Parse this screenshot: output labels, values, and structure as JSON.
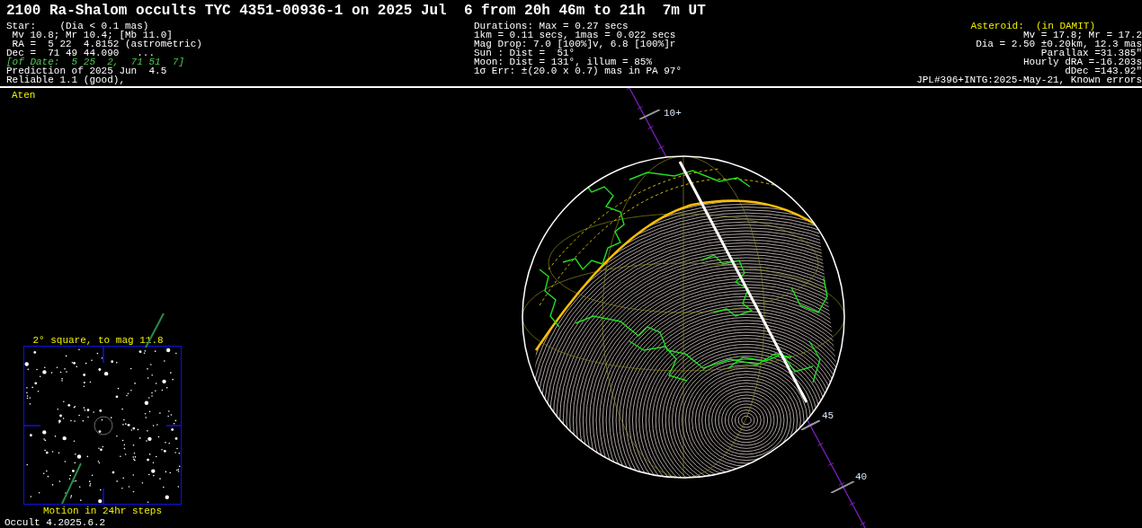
{
  "title": "2100 Ra-Shalom occults TYC 4351-00936-1 on 2025 Jul  6 from 20h 46m to 21h  7m UT",
  "star_info": [
    {
      "kind": "plain",
      "text": "Star:    (Dia < 0.1 mas)"
    },
    {
      "kind": "plain",
      "text": " Mv 10.8; Mr 10.4; [Mb 11.0]"
    },
    {
      "kind": "plain",
      "text": " RA =  5 22  4.8152 (astrometric)"
    },
    {
      "kind": "plain",
      "text": "Dec =  71 49 44.090   ..."
    },
    {
      "kind": "of_date",
      "text": "[of Date:  5 25  2,  71 51  7]"
    },
    {
      "kind": "plain",
      "text": "Prediction of 2025 Jun  4.5"
    },
    {
      "kind": "plain",
      "text": "Reliable 1.1 (good),"
    }
  ],
  "event_info": [
    "Durations: Max = 0.27 secs",
    "1km = 0.11 secs, 1mas = 0.022 secs",
    "Mag Drop: 7.0 [100%]v, 6.8 [100%]r",
    "Sun : Dist =  51°",
    "Moon: Dist = 131°, illum = 85%",
    "1σ Err: ±(20.0 x 0.7) mas in PA 97°"
  ],
  "asteroid_info": [
    {
      "kind": "heading",
      "text": "Asteroid:  (in DAMIT)"
    },
    {
      "kind": "plain",
      "text": "Mv = 17.8; Mr = 17.2"
    },
    {
      "kind": "plain",
      "text": "Dia = 2.50 ±0.20km, 12.3 mas"
    },
    {
      "kind": "plain",
      "text": "Parallax =31.385\""
    },
    {
      "kind": "plain",
      "text": "Hourly dRA =-16.203s"
    },
    {
      "kind": "plain",
      "text": "dDec =143.92\""
    },
    {
      "kind": "plain",
      "text": "JPL#396+INTG:2025-May-21, Known errors"
    }
  ],
  "orbit_class": "Aten",
  "track_labels": [
    {
      "text": "10+"
    },
    {
      "text": "45"
    },
    {
      "text": "40"
    }
  ],
  "finder_chart": {
    "title": "2° square, to mag 11.8",
    "caption": "Motion in 24hr steps"
  },
  "version": "Occult 4.2025.6.2"
}
